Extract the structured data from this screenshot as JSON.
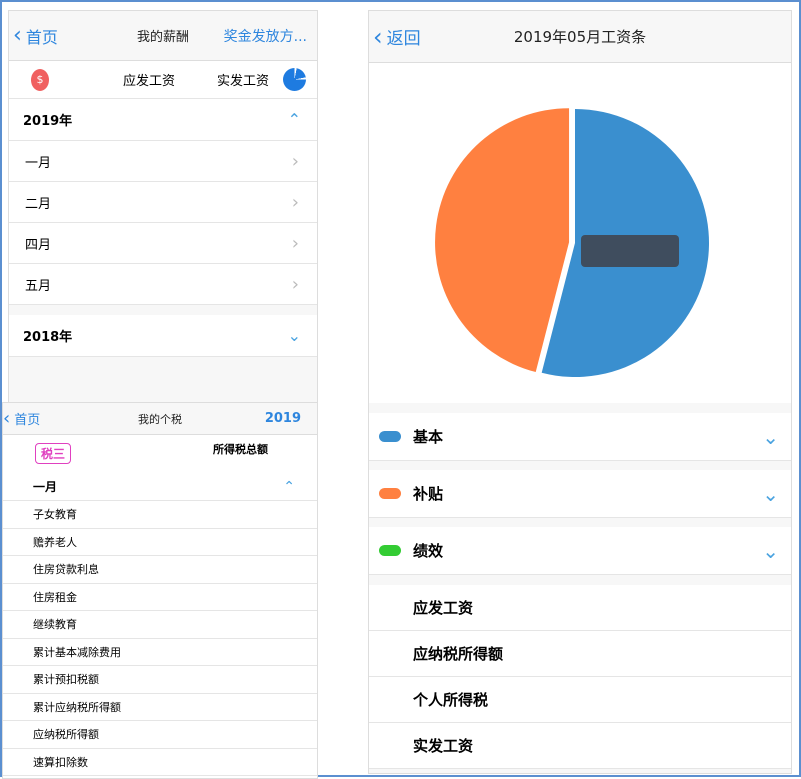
{
  "salary": {
    "back": "首页",
    "title": "我的薪酬",
    "right": "奖金发放方...",
    "tabs": [
      "应发工资",
      "实发工资"
    ],
    "years": [
      {
        "label": "2019年",
        "months": [
          "一月",
          "二月",
          "四月",
          "五月"
        ]
      },
      {
        "label": "2018年"
      }
    ]
  },
  "tax": {
    "back": "首页",
    "title": "我的个税",
    "year": "2019",
    "badge": "税三",
    "total_label": "所得税总额",
    "month": "一月",
    "items": [
      "子女教育",
      "赡养老人",
      "住房贷款利息",
      "住房租金",
      "继续教育",
      "累计基本减除费用",
      "累计预扣税额",
      "累计应纳税所得额",
      "应纳税所得额",
      "速算扣除数"
    ]
  },
  "payslip": {
    "back": "返回",
    "title": "2019年05月工资条",
    "chart_data": {
      "type": "pie",
      "slices": [
        {
          "name": "基本",
          "fraction": 0.54,
          "color": "#3a8fcf"
        },
        {
          "name": "补贴",
          "fraction": 0.46,
          "color": "#ff8040"
        }
      ]
    },
    "categories": [
      {
        "label": "基本",
        "color": "#3a8fcf"
      },
      {
        "label": "补贴",
        "color": "#ff8040"
      },
      {
        "label": "绩效",
        "color": "#33cc33"
      }
    ],
    "summary": [
      "应发工资",
      "应纳税所得额",
      "个人所得税",
      "实发工资"
    ]
  }
}
